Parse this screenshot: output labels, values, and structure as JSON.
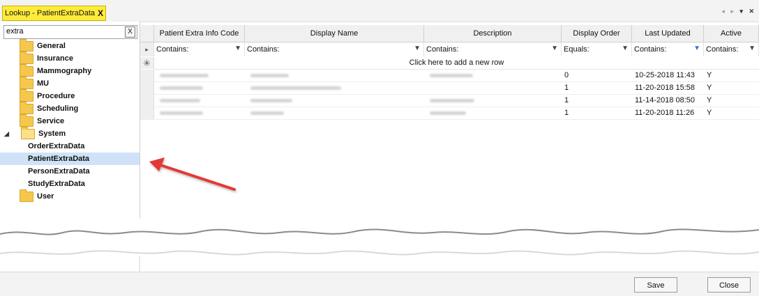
{
  "tab": {
    "title": "Lookup - PatientExtraData",
    "close": "X"
  },
  "window_controls": {
    "prev": "◂",
    "next": "▸",
    "menu": "▾",
    "close": "✕"
  },
  "search": {
    "value": "extra",
    "clear": "X"
  },
  "tree": {
    "folders_top": [
      "General",
      "Insurance",
      "Mammography",
      "MU",
      "Procedure",
      "Scheduling",
      "Service"
    ],
    "system": {
      "label": "System",
      "children": [
        "OrderExtraData",
        "PatientExtraData",
        "PersonExtraData",
        "StudyExtraData"
      ],
      "selected": "PatientExtraData"
    },
    "folders_bottom": [
      "User"
    ]
  },
  "grid": {
    "headers": [
      "Patient Extra Info Code",
      "Display Name",
      "Description",
      "Display Order",
      "Last Updated",
      "Active"
    ],
    "filters": [
      "Contains:",
      "Contains:",
      "Contains:",
      "Equals:",
      "Contains:",
      "Contains:"
    ],
    "add_row": "Click here to add a new row",
    "rows": [
      {
        "order": "0",
        "updated": "10-25-2018 11:43",
        "active": "Y"
      },
      {
        "order": "1",
        "updated": "11-20-2018 15:58",
        "active": "Y"
      },
      {
        "order": "1",
        "updated": "11-14-2018 08:50",
        "active": "Y"
      },
      {
        "order": "1",
        "updated": "11-20-2018 11:26",
        "active": "Y"
      }
    ]
  },
  "buttons": {
    "save": "Save",
    "close": "Close"
  },
  "colors": {
    "tab": "#ffeb3b",
    "selection": "#cfe2f7",
    "arrow": "#e53935",
    "filter_active": "#2a7ad8"
  }
}
